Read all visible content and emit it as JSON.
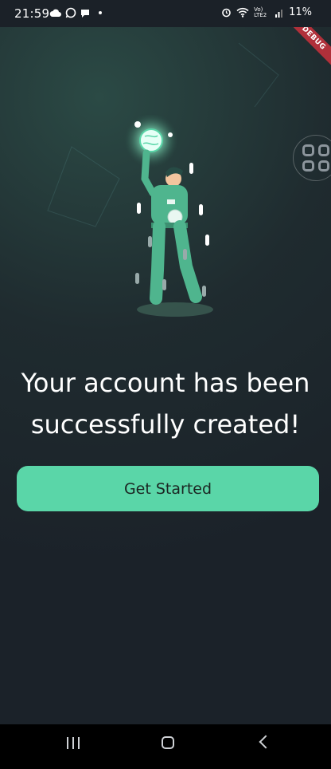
{
  "status_bar": {
    "time": "21:59",
    "network_label": "Vo) LTE2",
    "battery": "11%",
    "icons": [
      "cloud-icon",
      "whatsapp-icon",
      "chat-icon",
      "alarm-icon",
      "wifi-icon",
      "signal-icon"
    ]
  },
  "debug_banner": "DEBUG",
  "main": {
    "headline": "Your account has been successfully created!",
    "cta_label": "Get Started"
  },
  "colors": {
    "accent": "#5ad6a8",
    "background": "#1b2229",
    "debug": "#b0303a"
  },
  "nav": {
    "icons": [
      "recent-apps-icon",
      "home-icon",
      "back-icon"
    ]
  }
}
